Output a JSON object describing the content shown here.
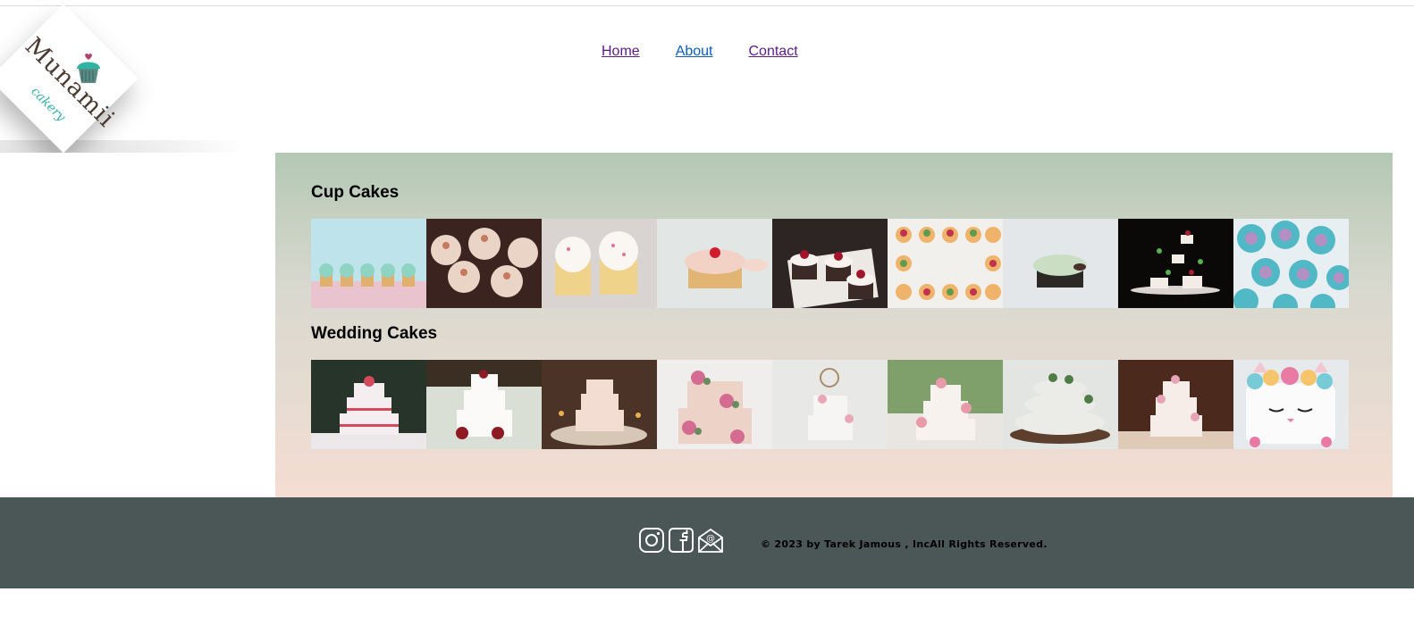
{
  "brand": {
    "name": "Munamii",
    "tagline": "cakery"
  },
  "nav": {
    "home": "Home",
    "about": "About",
    "contact": "Contact"
  },
  "sections": {
    "cupcakes": {
      "title": "Cup Cakes"
    },
    "wedding": {
      "title": "Wedding Cakes"
    }
  },
  "footer": {
    "copyright": "© 2023 by Tarek Jamous , IncAll Rights Reserved.",
    "social": [
      "instagram-icon",
      "facebook-icon",
      "email-icon"
    ]
  },
  "colors": {
    "footer_bg": "#4b5656",
    "gallery_top": "#b4c8b4",
    "gallery_bottom": "#f5ddd3",
    "brand_teal": "#2fb3a3"
  }
}
